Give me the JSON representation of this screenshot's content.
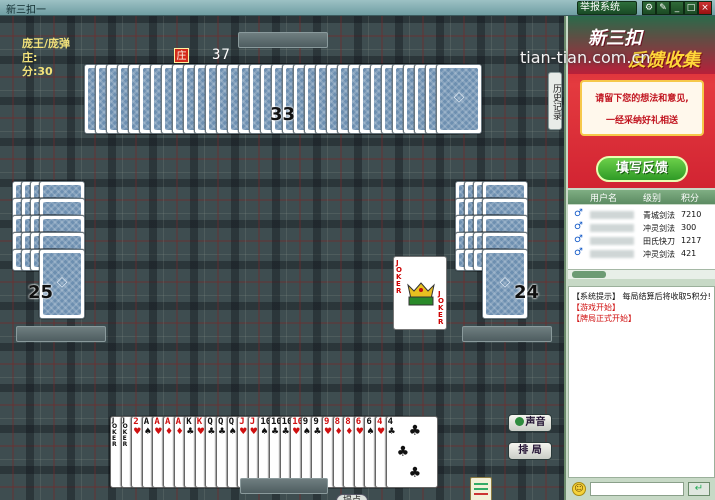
{
  "window": {
    "title": "新三扣一",
    "report_label": "举报系统",
    "btn_settings": "⚙",
    "btn_skin": "✎",
    "btn_min": "_",
    "btn_max": "□",
    "btn_close": "×"
  },
  "info": {
    "role": "庞王/庞弹",
    "zhuang_label": "庄:",
    "score_label": "分:30",
    "zhuang_badge": "庄",
    "timer": "37"
  },
  "counts": {
    "top": "33",
    "left": "25",
    "right": "24"
  },
  "history_label": "历史记录",
  "played": {
    "joker_text": "JOKER"
  },
  "hand": [
    {
      "rank": "JOKER",
      "suit": "",
      "color": "blk",
      "joker": true
    },
    {
      "rank": "JOKER",
      "suit": "",
      "color": "blk",
      "joker": true
    },
    {
      "rank": "2",
      "suit": "♥",
      "color": "red"
    },
    {
      "rank": "A",
      "suit": "♠",
      "color": "blk"
    },
    {
      "rank": "A",
      "suit": "♥",
      "color": "red"
    },
    {
      "rank": "A",
      "suit": "♦",
      "color": "red"
    },
    {
      "rank": "A",
      "suit": "♦",
      "color": "red"
    },
    {
      "rank": "K",
      "suit": "♣",
      "color": "blk"
    },
    {
      "rank": "K",
      "suit": "♥",
      "color": "red"
    },
    {
      "rank": "Q",
      "suit": "♣",
      "color": "blk"
    },
    {
      "rank": "Q",
      "suit": "♣",
      "color": "blk"
    },
    {
      "rank": "Q",
      "suit": "♠",
      "color": "blk"
    },
    {
      "rank": "J",
      "suit": "♥",
      "color": "red"
    },
    {
      "rank": "J",
      "suit": "♥",
      "color": "red"
    },
    {
      "rank": "10",
      "suit": "♠",
      "color": "blk"
    },
    {
      "rank": "10",
      "suit": "♣",
      "color": "blk"
    },
    {
      "rank": "10",
      "suit": "♣",
      "color": "blk"
    },
    {
      "rank": "10",
      "suit": "♥",
      "color": "red"
    },
    {
      "rank": "9",
      "suit": "♠",
      "color": "blk"
    },
    {
      "rank": "9",
      "suit": "♣",
      "color": "blk"
    },
    {
      "rank": "9",
      "suit": "♥",
      "color": "red"
    },
    {
      "rank": "8",
      "suit": "♦",
      "color": "red"
    },
    {
      "rank": "8",
      "suit": "♦",
      "color": "red"
    },
    {
      "rank": "6",
      "suit": "♥",
      "color": "red"
    },
    {
      "rank": "6",
      "suit": "♠",
      "color": "blk"
    },
    {
      "rank": "4",
      "suit": "♥",
      "color": "red"
    },
    {
      "rank": "4",
      "suit": "♣",
      "color": "blk"
    }
  ],
  "buttons": {
    "sound": "声音",
    "sort": "排 局",
    "tip": "提点"
  },
  "ad": {
    "title1": "新三扣",
    "title2": "反馈收集",
    "line1": "请留下您的想法和意见,",
    "line2": "一经采纳好礼相送",
    "button": "填写反馈"
  },
  "watermark": "tian-tian.com.cn",
  "users": {
    "headers": {
      "name": "用户名",
      "level": "级别",
      "score": "积分"
    },
    "rows": [
      {
        "gender": "♂",
        "level": "青城剑法",
        "score": "7210"
      },
      {
        "gender": "♂",
        "level": "冲灵剑法",
        "score": "300"
      },
      {
        "gender": "♂",
        "level": "田氏快刀",
        "score": "1217"
      },
      {
        "gender": "♂",
        "level": "冲灵剑法",
        "score": "421"
      }
    ]
  },
  "chat": {
    "system": "【系统提示】 每局结算后将收取5积分!",
    "line1": "【游戏开始】",
    "line2": "【牌局正式开始】"
  },
  "chatbar": {
    "smile": "☺",
    "send": "↵"
  }
}
